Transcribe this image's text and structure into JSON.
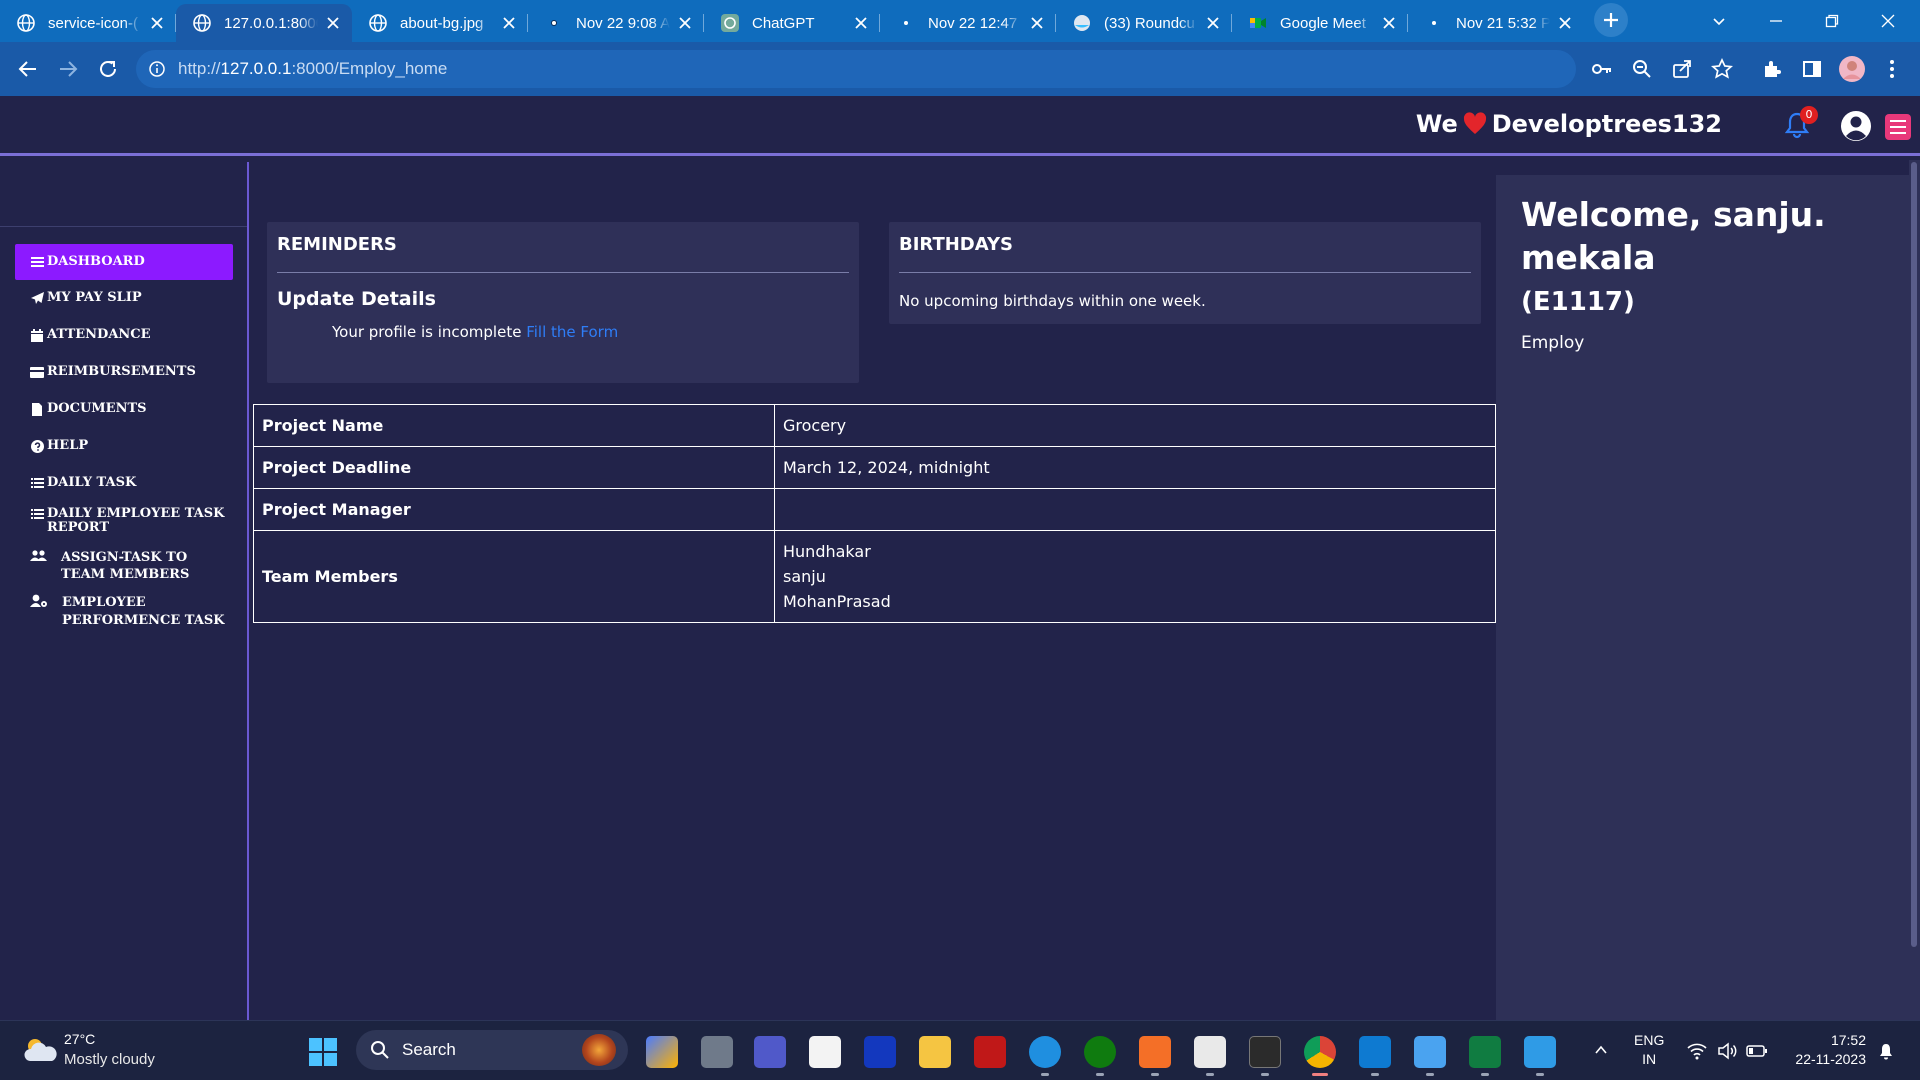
{
  "browser": {
    "tabs": [
      {
        "title": "service-icon-(",
        "icon": "globe-icon"
      },
      {
        "title": "127.0.0.1:8000",
        "icon": "globe-icon",
        "active": true
      },
      {
        "title": "about-bg.jpg",
        "icon": "globe-icon"
      },
      {
        "title": "Nov 22 9:08 A",
        "icon": "dot-icon"
      },
      {
        "title": "ChatGPT",
        "icon": "chatgpt-icon"
      },
      {
        "title": "Nov 22 12:47",
        "icon": "dot-icon"
      },
      {
        "title": "(33) Roundcu",
        "icon": "roundcube-icon"
      },
      {
        "title": "Google Meet",
        "icon": "google-meet-icon"
      },
      {
        "title": "Nov 21 5:32 P",
        "icon": "dot-icon"
      }
    ],
    "url_prefix": "http://",
    "url_host": "127.0.0.1",
    "url_path": ":8000/Employ_home"
  },
  "header": {
    "brand_before": "We",
    "brand_after": "Developtrees132",
    "notification_count": "0"
  },
  "sidebar": {
    "items": [
      {
        "label": "DASHBOARD",
        "icon": "bars-icon",
        "active": true
      },
      {
        "label": "MY PAY SLIP",
        "icon": "paper-plane-icon"
      },
      {
        "label": "ATTENDANCE",
        "icon": "calendar-icon"
      },
      {
        "label": "REIMBURSEMENTS",
        "icon": "credit-card-icon"
      },
      {
        "label": "DOCUMENTS",
        "icon": "file-icon"
      },
      {
        "label": "HELP",
        "icon": "question-circle-icon"
      },
      {
        "label": "DAILY TASK",
        "icon": "list-icon"
      },
      {
        "label": "DAILY EMPLOYEE TASK REPORT",
        "icon": "list-icon"
      },
      {
        "label": "ASSIGN-TASK TO TEAM MEMBERS",
        "icon": "users-icon"
      },
      {
        "label": "EMPLOYEE PERFORMENCE TASK",
        "icon": "user-cog-icon"
      }
    ]
  },
  "reminders": {
    "title": "REMINDERS",
    "subtitle": "Update Details",
    "text": "Your profile is incomplete",
    "link": "Fill the Form"
  },
  "birthdays": {
    "title": "BIRTHDAYS",
    "text": "No upcoming birthdays within one week."
  },
  "project": {
    "rows": [
      {
        "key": "Project Name",
        "value": "Grocery"
      },
      {
        "key": "Project Deadline",
        "value": "March 12, 2024, midnight"
      },
      {
        "key": "Project Manager",
        "value": ""
      }
    ],
    "members_key": "Team Members",
    "members": [
      "Hundhakar",
      "sanju",
      "MohanPrasad"
    ]
  },
  "profile": {
    "welcome": "Welcome, sanju. mekala",
    "emp_id": "(E1117)",
    "role": "Employ"
  },
  "taskbar": {
    "temperature": "27°C",
    "weather": "Mostly cloudy",
    "search_label": "Search",
    "lang_1": "ENG",
    "lang_2": "IN",
    "time": "17:52",
    "date": "22-11-2023"
  },
  "colors": {
    "page_bg": "#22234a",
    "card_bg": "#2f3058",
    "active_nav": "#8c1aff",
    "link": "#2f7df6",
    "browser_accent": "#0f6cbd"
  }
}
